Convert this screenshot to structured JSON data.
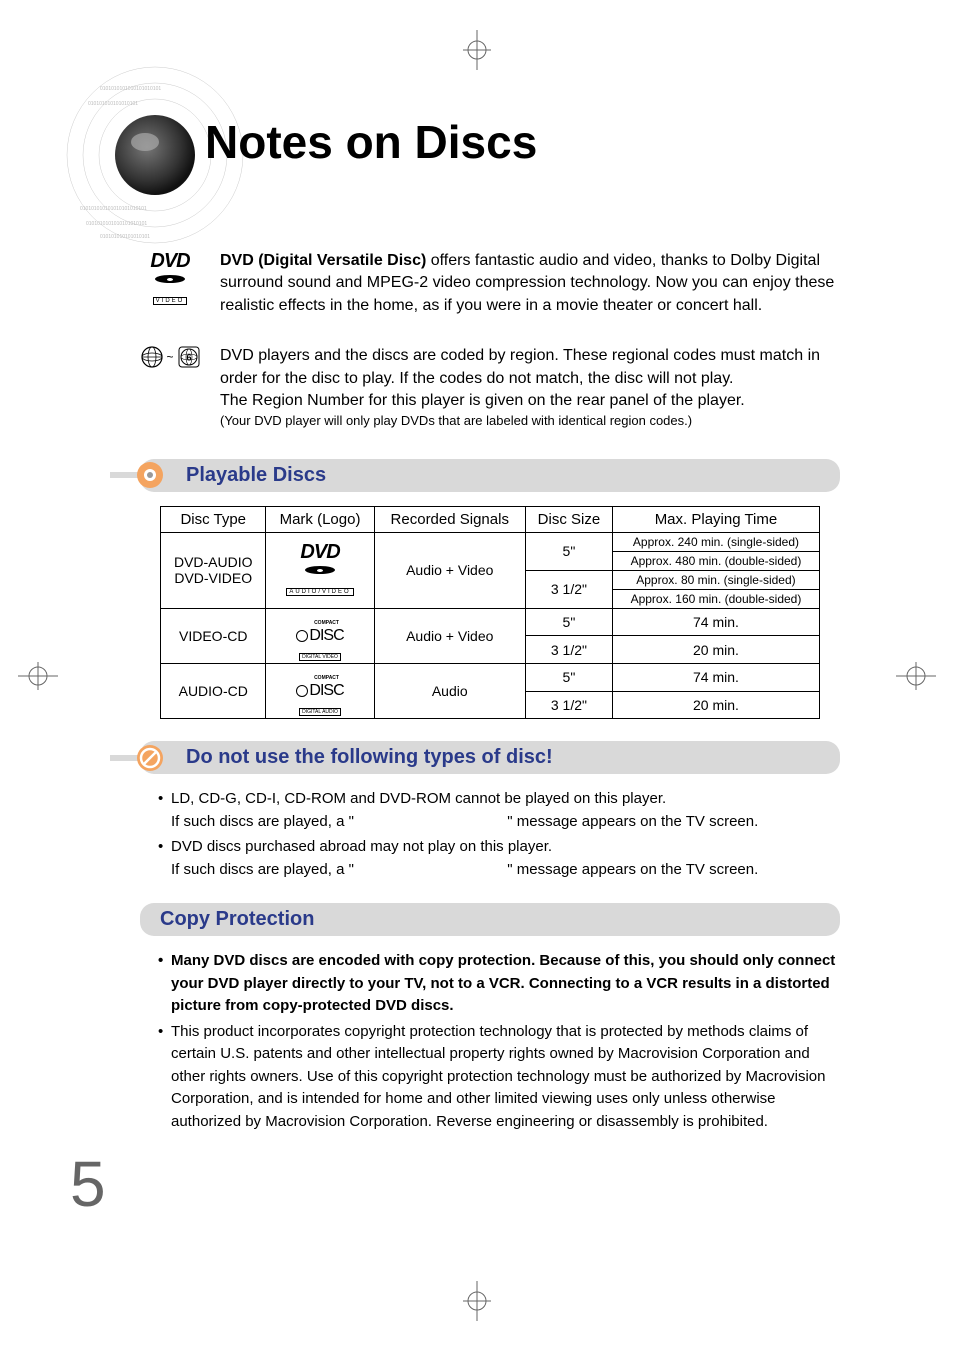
{
  "page_title": "Notes on Discs",
  "page_number": "5",
  "intro1": {
    "bold": "DVD (Digital Versatile Disc)",
    "text": " offers fantastic audio and video, thanks to Dolby Digital surround sound and MPEG-2 video compression technology. Now you can enjoy these realistic effects in the home, as if you were in a movie theater or concert hall."
  },
  "intro2": {
    "line1": "DVD players and the discs are coded by region. These regional codes must match in order for the disc to play. If the codes do not match, the disc will not play.",
    "line2": "The Region Number for this player is given on the rear panel of the player.",
    "line3": "(Your DVD player will only play DVDs that are labeled with identical region codes.)"
  },
  "region_tilde": "~",
  "logos": {
    "dvd_video_label": "VIDEO",
    "dvd_av_label": "AUDIO/VIDEO",
    "cd_compact": "COMPACT",
    "cd_disc": "DISC",
    "cd_video_label": "DIGITAL VIDEO",
    "cd_audio_label": "DIGITAL AUDIO",
    "region_6": "6"
  },
  "sections": {
    "playable": "Playable Discs",
    "donot": "Do not use the following types of disc!",
    "copy": "Copy Protection"
  },
  "table": {
    "headers": {
      "disc_type": "Disc Type",
      "mark": "Mark (Logo)",
      "signals": "Recorded Signals",
      "size": "Disc Size",
      "max_time": "Max. Playing Time"
    },
    "rows": {
      "r1_type_a": "DVD-AUDIO",
      "r1_type_b": "DVD-VIDEO",
      "r1_signals": "Audio + Video",
      "r1_size_a": "5\"",
      "r1_size_b": "3 1/2\"",
      "r1_time_a": "Approx. 240 min. (single-sided)",
      "r1_time_b": "Approx. 480 min. (double-sided)",
      "r1_time_c": "Approx. 80 min. (single-sided)",
      "r1_time_d": "Approx. 160 min. (double-sided)",
      "r2_type": "VIDEO-CD",
      "r2_signals": "Audio + Video",
      "r2_size_a": "5\"",
      "r2_size_b": "3 1/2\"",
      "r2_time_a": "74 min.",
      "r2_time_b": "20 min.",
      "r3_type": "AUDIO-CD",
      "r3_signals": "Audio",
      "r3_size_a": "5\"",
      "r3_size_b": "3 1/2\"",
      "r3_time_a": "74 min.",
      "r3_time_b": "20 min."
    }
  },
  "donot_items": {
    "b1": "LD, CD-G, CD-I, CD-ROM and DVD-ROM cannot be played on this player.",
    "b1_sub_a": "If such discs are played, a \"",
    "b1_sub_b": "\" message appears on the TV screen.",
    "b2": "DVD discs purchased abroad may not play on this player.",
    "b2_sub_a": "If such discs are played, a \"",
    "b2_sub_b": "\" message appears on the TV screen."
  },
  "copy_items": {
    "b1": "Many DVD discs are encoded with copy protection. Because of this, you should only connect your DVD player directly to your TV, not to a VCR. Connecting to a VCR results in a distorted picture from copy-protected DVD discs.",
    "b2": "This product incorporates copyright protection technology that is protected by methods claims of certain U.S. patents and other intellectual property rights owned by Macrovision Corporation and other rights owners. Use of this copyright protection technology must be authorized by Macrovision Corporation, and is intended for home and other limited viewing uses only unless otherwise authorized by Macrovision Corporation. Reverse engineering or disassembly is prohibited."
  }
}
